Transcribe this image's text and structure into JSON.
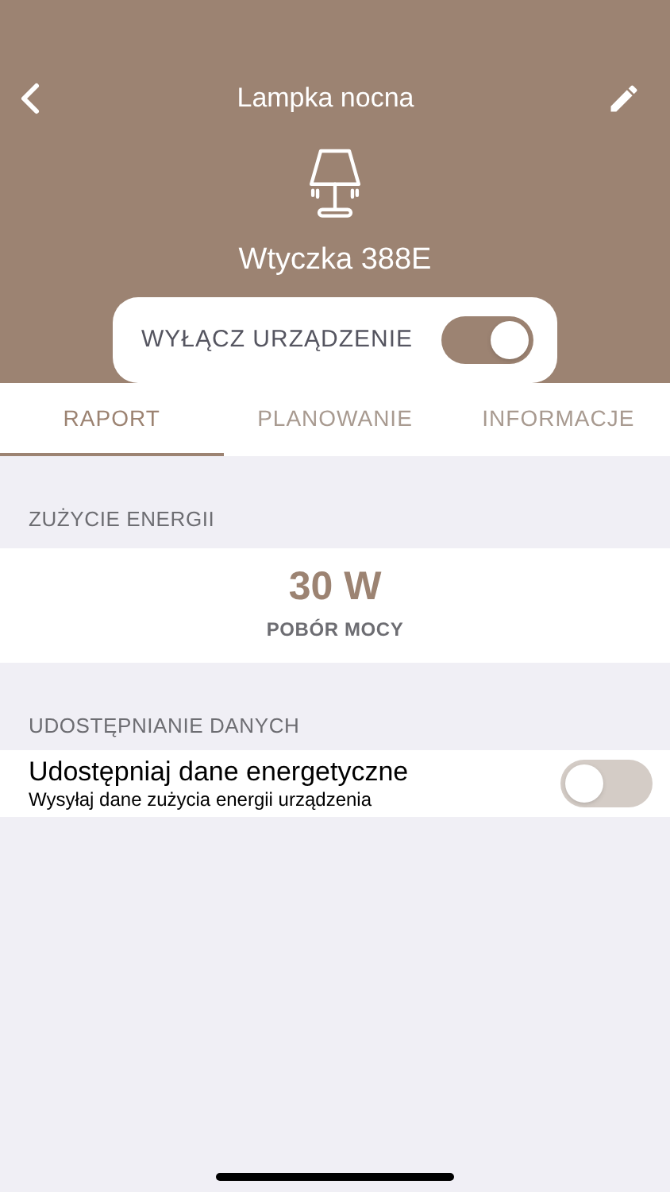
{
  "header": {
    "title": "Lampka nocna",
    "device_name": "Wtyczka 388E",
    "power_toggle": {
      "label": "WYŁĄCZ URZĄDZENIE",
      "on": true
    }
  },
  "tabs": [
    {
      "label": "RAPORT",
      "selected": true
    },
    {
      "label": "PLANOWANIE",
      "selected": false
    },
    {
      "label": "INFORMACJE",
      "selected": false
    }
  ],
  "energy": {
    "section": "ZUŻYCIE ENERGII",
    "value": "30 W",
    "caption": "POBÓR MOCY"
  },
  "sharing": {
    "section": "UDOSTĘPNIANIE DANYCH",
    "title": "Udostępniaj dane energetyczne",
    "subtitle": "Wysyłaj dane zużycia energii urządzenia",
    "on": false
  }
}
